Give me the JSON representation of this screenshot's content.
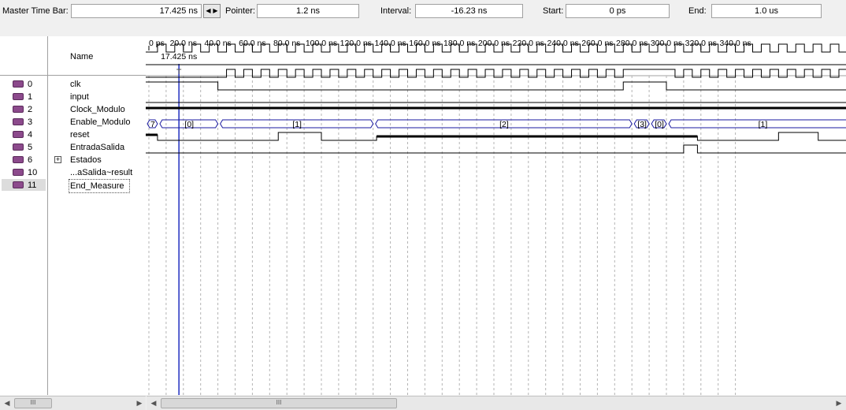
{
  "toolbar": {
    "master_label": "Master Time Bar:",
    "master_value": "17.425 ns",
    "pointer_label": "Pointer:",
    "pointer_value": "1.2 ns",
    "interval_label": "Interval:",
    "interval_value": "-16.23 ns",
    "start_label": "Start:",
    "start_value": "0 ps",
    "end_label": "End:",
    "end_value": "1.0 us"
  },
  "header": {
    "name_col": "Name",
    "cursor_label": "17.425 ns",
    "ticks": [
      "0 ps",
      "20.0 ns",
      "40.0 ns",
      "60.0 ns",
      "80.0 ns",
      "100.0 ns",
      "120.0 ns",
      "140.0 ns",
      "160.0 ns",
      "180.0 ns",
      "200.0 ns",
      "220.0 ns",
      "240.0 ns",
      "260.0 ns",
      "280.0 ns",
      "300.0 ns",
      "320.0 ns",
      "340.0 ns"
    ]
  },
  "signals": [
    {
      "index": "0",
      "name": "clk"
    },
    {
      "index": "1",
      "name": "input"
    },
    {
      "index": "2",
      "name": "Clock_Modulo"
    },
    {
      "index": "3",
      "name": "Enable_Modulo"
    },
    {
      "index": "4",
      "name": "reset"
    },
    {
      "index": "5",
      "name": "EntradaSalida"
    },
    {
      "index": "6",
      "name": "Estados"
    },
    {
      "index": "10",
      "name": "...aSalida~result"
    },
    {
      "index": "11",
      "name": "End_Measure"
    }
  ],
  "bus_labels": {
    "estados": [
      "7",
      "[0]",
      "[1]",
      "[2]",
      "[3]",
      "[0]",
      "[1]"
    ]
  },
  "scrollbar": {
    "left_thumb": "III",
    "right_thumb": "III"
  },
  "colors": {
    "wave": "#000000",
    "bus": "#1a1aa0",
    "cursor": "#2030c0",
    "grid": "#b4b4b4"
  }
}
